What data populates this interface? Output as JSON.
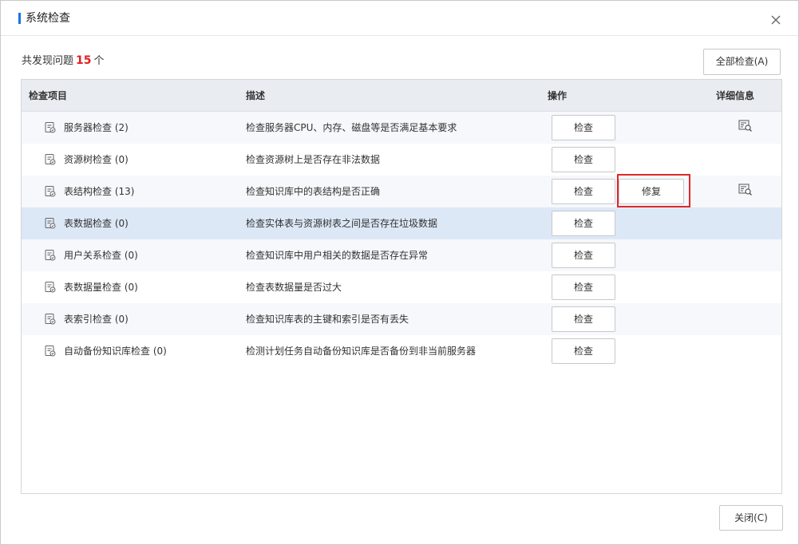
{
  "dialog": {
    "title": "系统检查",
    "close_icon": "close-icon"
  },
  "summary": {
    "prefix": "共发现问题",
    "count": "15",
    "suffix": "个"
  },
  "buttons": {
    "check_all": "全部检查(A)",
    "close": "关闭(C)"
  },
  "table": {
    "headers": {
      "item": "检查项目",
      "desc": "描述",
      "op": "操作",
      "detail": "详细信息"
    },
    "rows": [
      {
        "name": "服务器检查 (2)",
        "desc": "检查服务器CPU、内存、磁盘等是否满足基本要求",
        "check": "检查",
        "fix": "",
        "has_detail": true,
        "selected": false
      },
      {
        "name": "资源树检查 (0)",
        "desc": "检查资源树上是否存在非法数据",
        "check": "检查",
        "fix": "",
        "has_detail": false,
        "selected": false
      },
      {
        "name": "表结构检查 (13)",
        "desc": "检查知识库中的表结构是否正确",
        "check": "检查",
        "fix": "修复",
        "has_detail": true,
        "selected": false
      },
      {
        "name": "表数据检查 (0)",
        "desc": "检查实体表与资源树表之间是否存在垃圾数据",
        "check": "检查",
        "fix": "",
        "has_detail": false,
        "selected": true
      },
      {
        "name": "用户关系检查 (0)",
        "desc": "检查知识库中用户相关的数据是否存在异常",
        "check": "检查",
        "fix": "",
        "has_detail": false,
        "selected": false
      },
      {
        "name": "表数据量检查 (0)",
        "desc": "检查表数据量是否过大",
        "check": "检查",
        "fix": "",
        "has_detail": false,
        "selected": false
      },
      {
        "name": "表索引检查 (0)",
        "desc": "检查知识库表的主键和索引是否有丢失",
        "check": "检查",
        "fix": "",
        "has_detail": false,
        "selected": false
      },
      {
        "name": "自动备份知识库检查 (0)",
        "desc": "检测计划任务自动备份知识库是否备份到非当前服务器",
        "check": "检查",
        "fix": "",
        "has_detail": false,
        "selected": false
      }
    ]
  },
  "colors": {
    "accent": "#1a73e8",
    "count": "#e02020",
    "highlight_border": "#e02828",
    "selected_row": "#dde8f7"
  }
}
